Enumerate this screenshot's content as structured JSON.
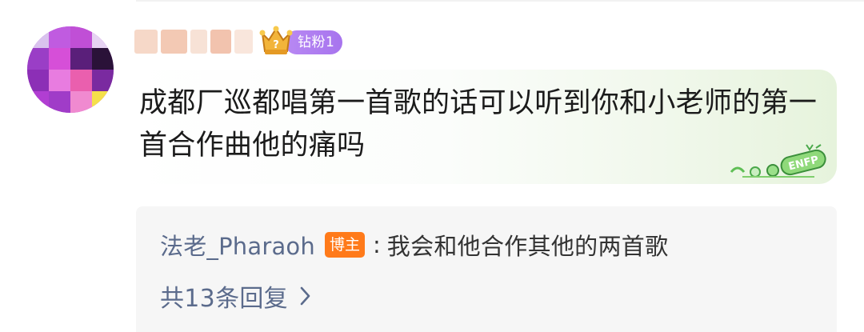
{
  "comment": {
    "badge_label": "钻粉1",
    "text": "成都厂巡都唱第一首歌的话可以听到你和小老师的第一首合作曲他的痛吗",
    "decoration_text": "ENFP"
  },
  "reply_preview": {
    "author": "法老_Pharaoh",
    "author_tag": "博主",
    "colon": ":",
    "content": "我会和他合作其他的两首歌",
    "count_label": "共13条回复"
  },
  "colors": {
    "badge_purple": "#a774ee",
    "blogger_tag_orange": "#ff7a1a",
    "link_blue_gray": "#5b6b8c",
    "bubble_green": "#e6f3dc"
  },
  "icons": {
    "fan_badge": "crown-fan-icon",
    "reply_more": "chevron-right-icon",
    "decoration": "enfp-sticker-icon"
  }
}
